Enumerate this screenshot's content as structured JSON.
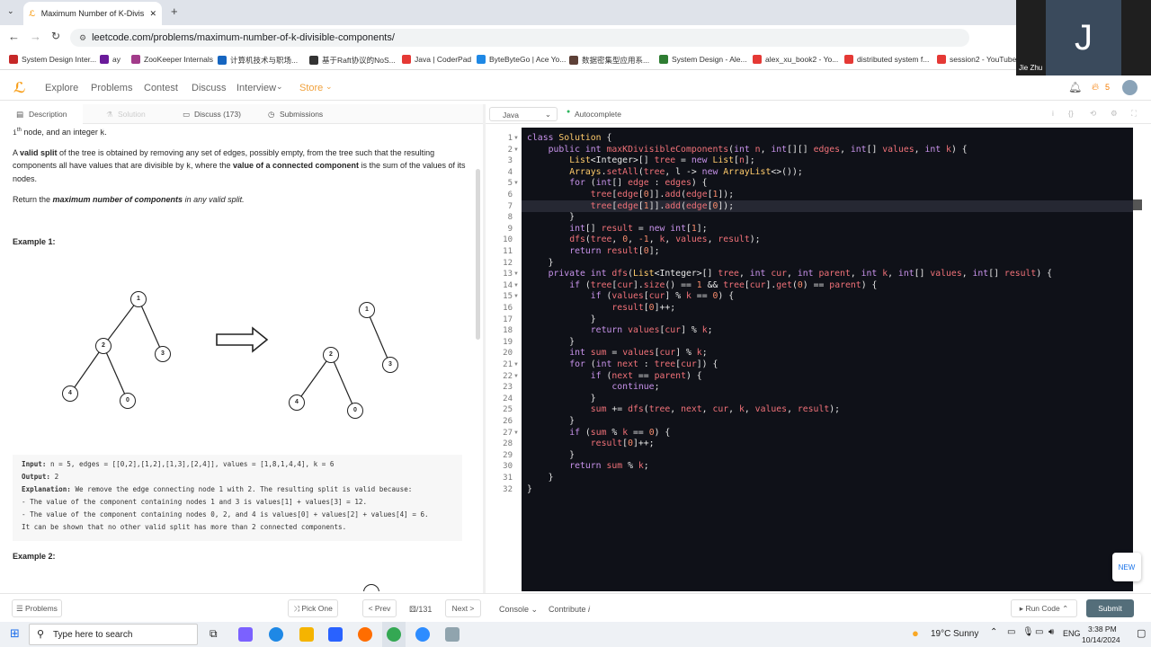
{
  "browser": {
    "tab_title": "Maximum Number of K-Divisib",
    "url": "leetcode.com/problems/maximum-number-of-k-divisible-components/",
    "bookmarks": [
      {
        "label": "System Design Inter...",
        "color": "#c62828"
      },
      {
        "label": "ay",
        "color": "#6a1b9a"
      },
      {
        "label": "ZooKeeper Internals",
        "color": "#a23b8a"
      },
      {
        "label": "计算机技术与职场...",
        "color": "#1565c0"
      },
      {
        "label": "基于Raft协议的NoS...",
        "color": "#333333"
      },
      {
        "label": "Java | CoderPad",
        "color": "#e53935"
      },
      {
        "label": "ByteByteGo | Ace Yo...",
        "color": "#1e88e5"
      },
      {
        "label": "数据密集型应用系...",
        "color": "#5d4037"
      },
      {
        "label": "System Design - Ale...",
        "color": "#2e7d32"
      },
      {
        "label": "alex_xu_book2 - Yo...",
        "color": "#e53935"
      },
      {
        "label": "distributed system f...",
        "color": "#e53935"
      },
      {
        "label": "session2 - YouTube",
        "color": "#e53935"
      }
    ]
  },
  "video": {
    "initial": "J",
    "name": "Jie Zhu"
  },
  "nav": {
    "explore": "Explore",
    "problems": "Problems",
    "contest": "Contest",
    "discuss": "Discuss",
    "interview": "Interview",
    "store": "Store",
    "streak": "5"
  },
  "left_tabs": {
    "description": "Description",
    "solution": "Solution",
    "discuss": "Discuss (173)",
    "submissions": "Submissions"
  },
  "desc": {
    "p0a": "i",
    "p0sup": "th",
    "p0b": " node, and an integer ",
    "p0k": "k",
    "p1a": "A ",
    "p1b": "valid split",
    "p1c": " of the tree is obtained by removing any set of edges, possibly empty, from the tree such that the resulting components all have values that are divisible by ",
    "p1d": "k",
    "p1e": ", where the ",
    "p1f": "value of a connected component",
    "p1g": " is the sum of the values of its nodes.",
    "p2a": "Return the ",
    "p2b": "maximum number of components",
    "p2c": " in any valid split.",
    "example1": "Example 1:",
    "example2": "Example 2:",
    "input_label": "Input:",
    "input_val": " n = 5, edges = [[0,2],[1,2],[1,3],[2,4]], values = [1,8,1,4,4], k = 6",
    "output_label": "Output:",
    "output_val": " 2",
    "expl_label": "Explanation:",
    "expl_val": " We remove the edge connecting node 1 with 2. The resulting split is valid because:",
    "expl_l2": "- The value of the component containing nodes 1 and 3 is values[1] + values[3] = 12.",
    "expl_l3": "- The value of the component containing nodes 0, 2, and 4 is values[0] + values[2] + values[4] = 6.",
    "expl_l4": "It can be shown that no other valid split has more than 2 connected components.",
    "nodes": [
      "1",
      "2",
      "3",
      "4",
      "0"
    ]
  },
  "editor": {
    "language": "Java",
    "autocomplete": "Autocomplete",
    "line_numbers": [
      "1",
      "2",
      "3",
      "4",
      "5",
      "6",
      "7",
      "8",
      "9",
      "10",
      "11",
      "12",
      "13",
      "14",
      "15",
      "16",
      "17",
      "18",
      "19",
      "20",
      "21",
      "22",
      "23",
      "24",
      "25",
      "26",
      "27",
      "28",
      "29",
      "30",
      "31",
      "32"
    ]
  },
  "bottom": {
    "problems": "Problems",
    "pick_one": "Pick One",
    "prev": "< Prev",
    "page": "/131",
    "next": "Next >",
    "console": "Console",
    "contribute": "Contribute",
    "run_code": "Run Code",
    "submit": "Submit",
    "new_badge": "NEW"
  },
  "taskbar": {
    "search": "Type here to search",
    "weather_temp": "19°C",
    "weather_text": "Sunny",
    "lang": "ENG",
    "time": "3:38 PM",
    "date": "10/14/2024"
  }
}
